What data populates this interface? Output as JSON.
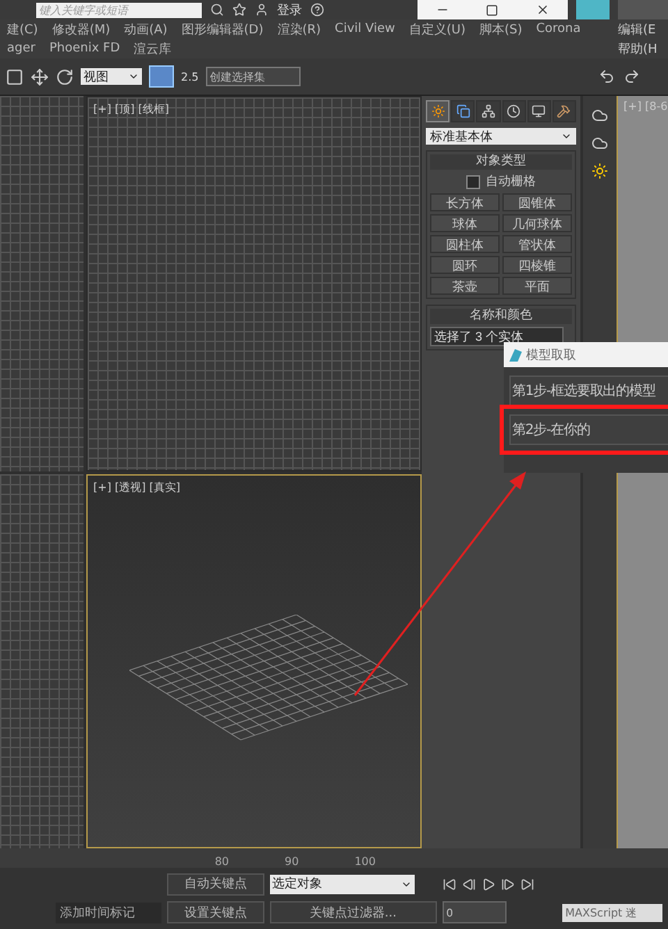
{
  "title_bar": {
    "search": {
      "placeholder": "键入关键字或短语"
    },
    "login": "登录"
  },
  "menu": [
    "建(C)",
    "修改器(M)",
    "动画(A)",
    "图形编辑器(D)",
    "渲染(R)",
    "Civil View",
    "自定义(U)",
    "脚本(S)",
    "Corona"
  ],
  "menu_row2": [
    "ager",
    "Phoenix FD",
    "渲云库"
  ],
  "right_menu": [
    "编辑(E",
    "帮助(H"
  ],
  "toolbar": {
    "view_select": "视图",
    "snap_value": "2.5",
    "selection_set": {
      "placeholder": "创建选择集"
    }
  },
  "viewports": [
    {
      "label": "[+] [顶] [线框]",
      "active": false,
      "kind": "grid"
    },
    {
      "label": "[+] [透视] [真实]",
      "active": true,
      "kind": "perspective"
    }
  ],
  "right_viewport": {
    "label": "[+] [8-6"
  },
  "command_panel": {
    "tabs": [
      {
        "kind": "create",
        "selected": true
      },
      {
        "kind": "modify",
        "selected": false
      },
      {
        "kind": "hierarchy",
        "selected": false
      },
      {
        "kind": "motion",
        "selected": false
      },
      {
        "kind": "display",
        "selected": false
      },
      {
        "kind": "utilities",
        "selected": false
      }
    ],
    "category": "标准基本体",
    "object_type": {
      "title": "对象类型",
      "autogrid": {
        "label": "自动栅格",
        "checked": false
      },
      "buttons": [
        "长方体",
        "圆锥体",
        "球体",
        "几何球体",
        "圆柱体",
        "管状体",
        "圆环",
        "四棱锥",
        "茶壶",
        "平面"
      ]
    },
    "name_color": {
      "title": "名称和颜色",
      "name": "选择了 3 个实体"
    }
  },
  "dialog": {
    "title": "模型取取",
    "steps": [
      {
        "label": "第1步-框选要取出的模型",
        "highlighted": false
      },
      {
        "label": "第2步-在你的",
        "highlighted": true
      }
    ]
  },
  "timeline": {
    "ticks": [
      "80",
      "90",
      "100"
    ]
  },
  "bottom": {
    "auto_key": "自动关键点",
    "key_target": "选定对象",
    "set_key": "设置关键点",
    "key_filters": "关键点过滤器...",
    "add_time_tag": "添加时间标记",
    "frame": "0",
    "maxscript": "MAXScript 迷"
  }
}
